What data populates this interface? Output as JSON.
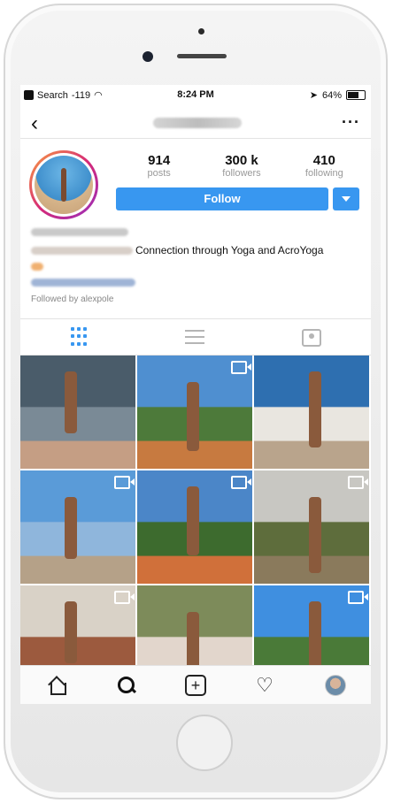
{
  "status_bar": {
    "back_app": "Search",
    "signal": "-119",
    "time": "8:24 PM",
    "battery": "64%"
  },
  "profile": {
    "stats": [
      {
        "value": "914",
        "label": "posts"
      },
      {
        "value": "300 k",
        "label": "followers"
      },
      {
        "value": "410",
        "label": "following"
      }
    ],
    "follow_label": "Follow",
    "bio_visible": "Connection through Yoga and AcroYoga",
    "followed_by": "Followed by alexpole"
  },
  "tabs": [
    "grid",
    "list",
    "tagged"
  ],
  "photos": [
    {
      "video": false,
      "colors": [
        "#4a5c6a",
        "#7a8a96",
        "#c59e84"
      ]
    },
    {
      "video": true,
      "colors": [
        "#4f8fd0",
        "#4d7a3a",
        "#c77a40"
      ]
    },
    {
      "video": false,
      "colors": [
        "#2e6fb0",
        "#e9e6e0",
        "#b9a48c"
      ]
    },
    {
      "video": true,
      "colors": [
        "#5a9bd8",
        "#8fb6dc",
        "#b5a188"
      ]
    },
    {
      "video": true,
      "colors": [
        "#4b86c8",
        "#3d6b2e",
        "#d0703a"
      ]
    },
    {
      "video": true,
      "colors": [
        "#c8c7c2",
        "#5e6d3c",
        "#8a7a5c"
      ]
    },
    {
      "video": true,
      "colors": [
        "#d9d2c7",
        "#9c5a3e",
        "#5b3b2e"
      ]
    },
    {
      "video": false,
      "colors": [
        "#7d8b5a",
        "#e2d6cc",
        "#d99a8e"
      ]
    },
    {
      "video": true,
      "colors": [
        "#3f8fe0",
        "#4a7a38",
        "#d46a3a"
      ]
    }
  ],
  "bottom_nav": [
    "home-icon",
    "search-icon",
    "add-icon",
    "heart-icon",
    "profile-icon"
  ],
  "accent_color": "#3897f0"
}
